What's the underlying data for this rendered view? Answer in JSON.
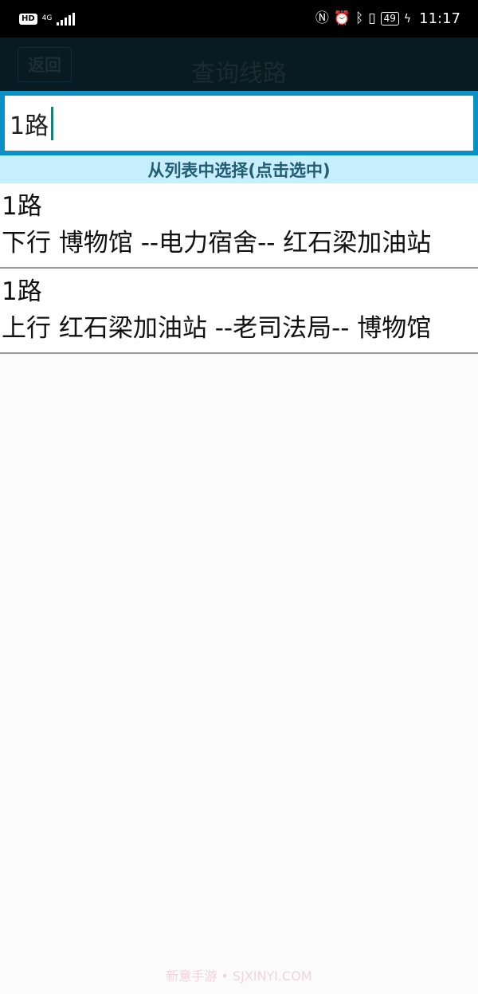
{
  "status_bar": {
    "hd": "HD",
    "network": "4G",
    "battery": "49",
    "time": "11:17",
    "icons": [
      "nfc-icon",
      "alarm-icon",
      "bluetooth-icon",
      "vibrate-icon",
      "charging-icon"
    ]
  },
  "header": {
    "back_label": "返回",
    "title": "查询线路"
  },
  "search": {
    "value": "1路"
  },
  "list_header": "从列表中选择(点击选中)",
  "routes": [
    {
      "name": "1路",
      "description": "下行 博物馆 --电力宿舍-- 红石梁加油站"
    },
    {
      "name": "1路",
      "description": "上行 红石梁加油站 --老司法局-- 博物馆"
    }
  ],
  "watermark": "新意手游 • SJXINYI.COM",
  "colors": {
    "search_border": "#0a90c6",
    "list_header_bg": "#c7eefc",
    "list_header_text": "#215d74"
  }
}
